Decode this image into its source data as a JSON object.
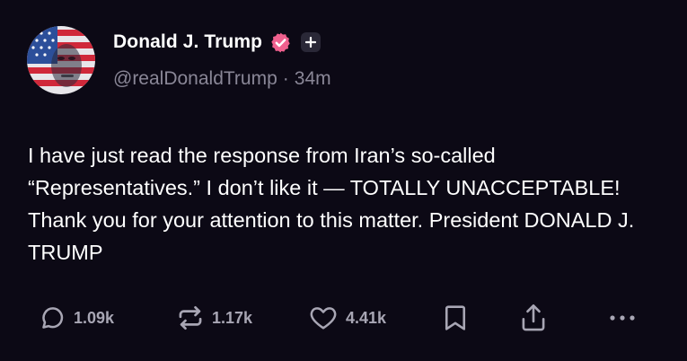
{
  "author": {
    "display_name": "Donald J. Trump",
    "handle": "@realDonaldTrump",
    "separator": "·",
    "time_ago": "34m",
    "verified": true
  },
  "post": {
    "text": "I have just read the response from Iran’s so-called “Representatives.” I don’t like it — TOTALLY UNACCEPTABLE! Thank you for your attention to this matter. President DONALD J. TRUMP"
  },
  "actions": {
    "replies": "1.09k",
    "reposts": "1.17k",
    "likes": "4.41k"
  },
  "icons": {
    "reply": "reply-icon",
    "repost": "repost-icon",
    "like": "heart-icon",
    "bookmark": "bookmark-icon",
    "share": "share-icon",
    "more": "more-icon",
    "verified": "verified-badge-icon",
    "add": "plus-icon"
  },
  "colors": {
    "background": "#0c0915",
    "text": "#ffffff",
    "muted": "#8a8797",
    "verified_badge": "#f0608e",
    "action_icon": "#a8a6b4"
  }
}
